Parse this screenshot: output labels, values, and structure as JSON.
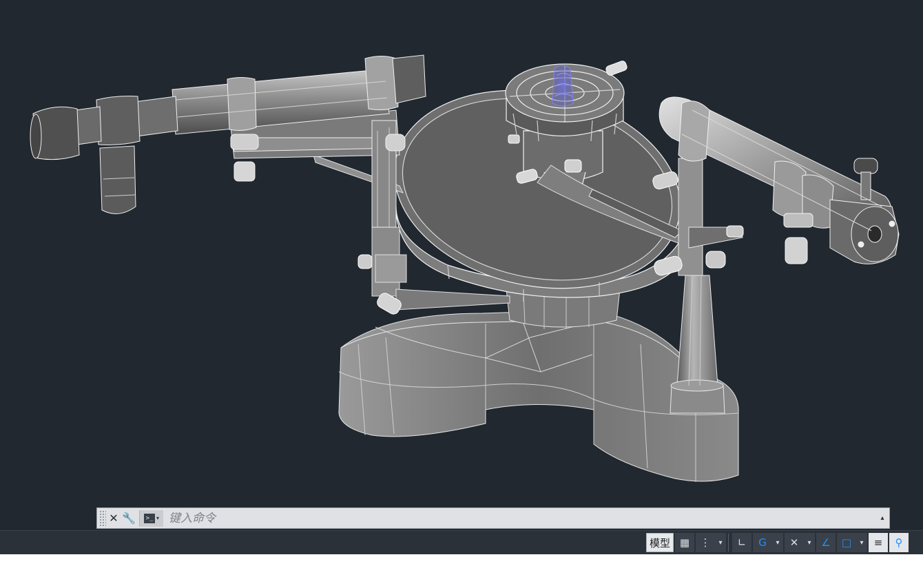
{
  "app": {
    "viewport_background": "#212830"
  },
  "command_line": {
    "close_glyph": "✕",
    "customize_glyph": "🔧",
    "prompt_glyph": ">_",
    "prompt_caret": "▾",
    "placeholder": "键入命令",
    "expand_glyph": "▴"
  },
  "status_bar": {
    "model_label": "模型",
    "buttons": [
      {
        "icon": "grid-icon",
        "glyph": "▦"
      },
      {
        "icon": "snap-icon",
        "glyph": "⋮"
      },
      {
        "icon": "ortho-icon",
        "glyph": "∟"
      },
      {
        "icon": "polar-tracking-icon",
        "glyph": "G"
      },
      {
        "icon": "object-snap-tracking-icon",
        "glyph": "✕"
      },
      {
        "icon": "isodraft-icon",
        "glyph": "∠"
      },
      {
        "icon": "object-snap-icon",
        "glyph": "□"
      },
      {
        "icon": "lineweight-icon",
        "glyph": "≡"
      },
      {
        "icon": "annotation-scale-icon",
        "glyph": "⚲"
      }
    ],
    "caret_glyph": "▾",
    "accent": "#1e8fff"
  }
}
